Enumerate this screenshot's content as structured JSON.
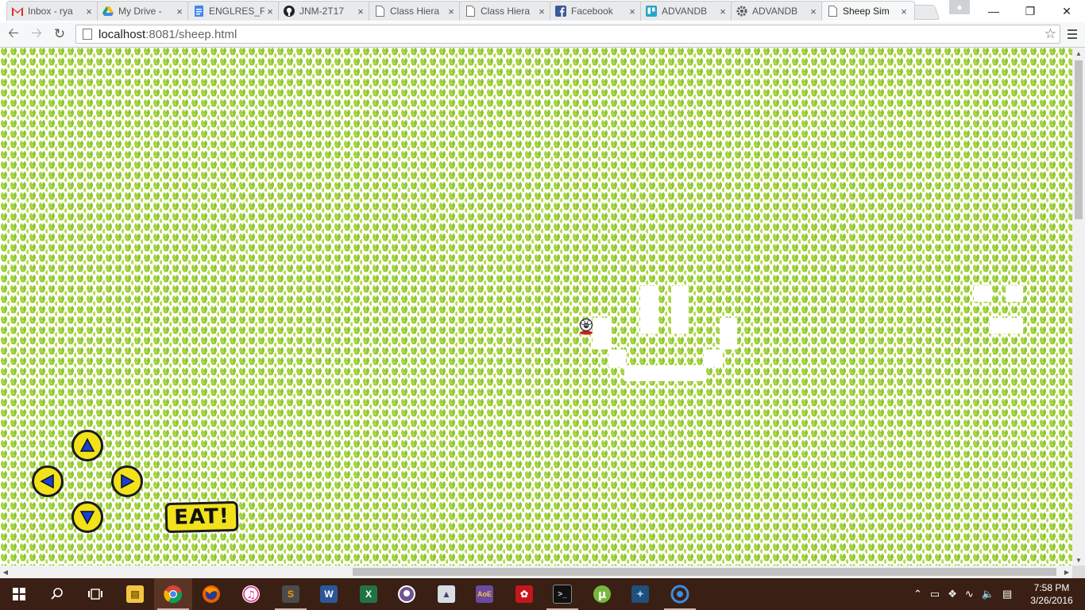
{
  "browser": {
    "tabs": [
      {
        "label": "Inbox - rya",
        "favicon": "gmail-icon",
        "color": "#d93025",
        "active": false
      },
      {
        "label": "My Drive -",
        "favicon": "google-drive-icon",
        "color": "#1fa463",
        "active": false
      },
      {
        "label": "ENGLRES_F",
        "favicon": "google-docs-icon",
        "color": "#4285f4",
        "active": false
      },
      {
        "label": "JNM-2T17",
        "favicon": "github-icon",
        "color": "#222222",
        "active": false
      },
      {
        "label": "Class Hiera",
        "favicon": "page-icon",
        "color": "#777777",
        "active": false
      },
      {
        "label": "Class Hiera",
        "favicon": "page-icon",
        "color": "#777777",
        "active": false
      },
      {
        "label": "Facebook",
        "favicon": "facebook-icon",
        "color": "#3b5998",
        "active": false
      },
      {
        "label": "ADVANDB",
        "favicon": "trello-icon",
        "color": "#26a6c8",
        "active": false
      },
      {
        "label": "ADVANDB",
        "favicon": "settings-gear-icon",
        "color": "#555555",
        "active": false
      },
      {
        "label": "Sheep Sim",
        "favicon": "page-icon",
        "color": "#777777",
        "active": true
      }
    ],
    "close_glyph": "×",
    "url_host": "localhost",
    "url_path": ":8081/sheep.html"
  },
  "game": {
    "controls": {
      "up": "up-arrow",
      "left": "left-arrow",
      "right": "right-arrow",
      "down": "down-arrow"
    },
    "eat_label": "EAT!",
    "button_color": "#f2e21a",
    "arrow_color": "#1a3fd6",
    "grass_color": "#9ccc2e"
  },
  "taskbar": {
    "apps": [
      {
        "name": "file-explorer-icon",
        "running": false
      },
      {
        "name": "chrome-icon",
        "running": true,
        "active": true
      },
      {
        "name": "firefox-icon",
        "running": false
      },
      {
        "name": "itunes-icon",
        "running": false
      },
      {
        "name": "sublime-text-icon",
        "running": true
      },
      {
        "name": "word-icon",
        "running": false
      },
      {
        "name": "excel-icon",
        "running": false
      },
      {
        "name": "github-desktop-icon",
        "running": false
      },
      {
        "name": "photos-icon",
        "running": false
      },
      {
        "name": "age-of-empires-icon",
        "running": false
      },
      {
        "name": "acrobat-icon",
        "running": false
      },
      {
        "name": "command-prompt-icon",
        "running": true
      },
      {
        "name": "utorrent-icon",
        "running": false
      },
      {
        "name": "mysql-workbench-icon",
        "running": false
      },
      {
        "name": "app-icon",
        "running": true
      }
    ],
    "time": "7:58 PM",
    "date": "3/26/2016"
  }
}
